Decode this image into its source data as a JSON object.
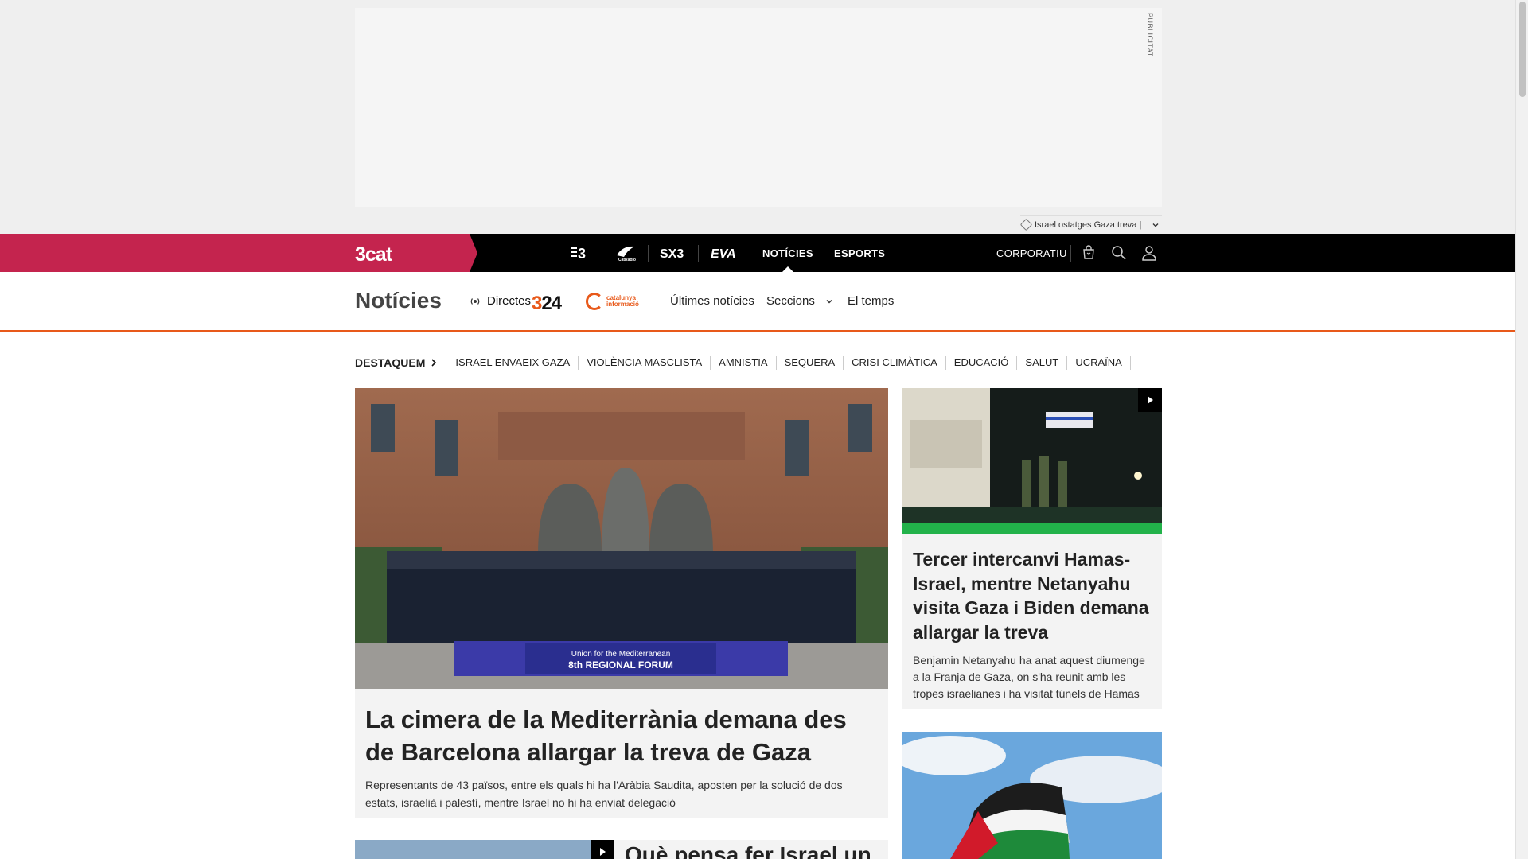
{
  "ad": {
    "label": "PUBLICITAT",
    "tag_text": "Israel ostatges Gaza treva |"
  },
  "topnav": {
    "logo": "3cat",
    "channels": [
      "3",
      "CatRàdio",
      "SX3",
      "EVA"
    ],
    "links": [
      {
        "label": "NOTÍCIES",
        "active": true
      },
      {
        "label": "ESPORTS",
        "active": false
      }
    ],
    "corporate": "CORPORATIU"
  },
  "section": {
    "title": "Notícies",
    "directes": "Directes",
    "logo_324": "324",
    "logo_catinfo_line1": "catalunya",
    "logo_catinfo_line2": "informació",
    "links": [
      "Últimes notícies",
      "Seccions",
      "El temps"
    ]
  },
  "highlights": {
    "title": "DESTAQUEM",
    "items": [
      "ISRAEL ENVAEIX GAZA",
      "VIOLÈNCIA MASCLISTA",
      "AMNISTIA",
      "SEQUERA",
      "CRISI CLIMÀTICA",
      "EDUCACIÓ",
      "SALUT",
      "UCRAÏNA"
    ]
  },
  "main_story": {
    "title": "La cimera de la Mediterrània demana des de Barcelona allargar la treva de Gaza",
    "summary": "Representants de 43 països, entre els quals hi ha l'Aràbia Saudita, aposten per la solució de dos estats, israelià i palestí, mentre Israel no hi ha enviat delegació",
    "banner_line1": "Union for the Mediterranean",
    "banner_line2": "8th REGIONAL FORUM"
  },
  "side_story": {
    "title": "Tercer intercanvi Hamas-Israel, mentre Netanyahu visita Gaza i Biden demana allargar la treva",
    "summary": "Benjamin Netanyahu ha anat aquest diumenge a la Franja de Gaza, on s'ha reunit amb les tropes israelianes i ha visitat túnels de Hamas"
  },
  "bottom_story": {
    "title": "Què pensa fer Israel un"
  },
  "colors": {
    "brand": "#c4244e",
    "accent": "#e8591a"
  }
}
